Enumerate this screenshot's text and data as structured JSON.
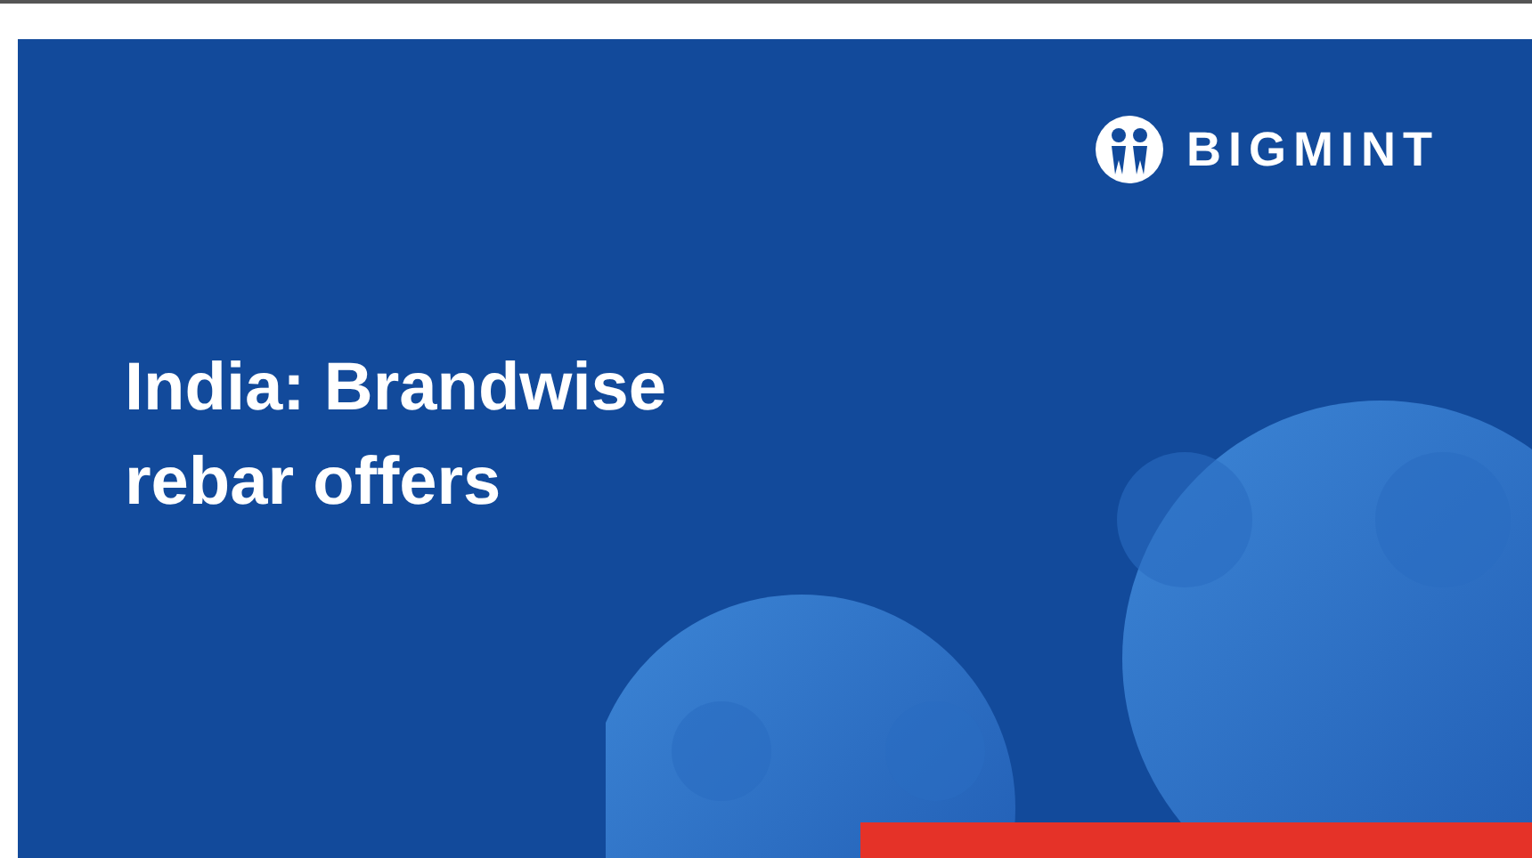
{
  "banner": {
    "logo": {
      "text": "BIGMINT"
    },
    "title": "India: Brandwise rebar offers"
  }
}
